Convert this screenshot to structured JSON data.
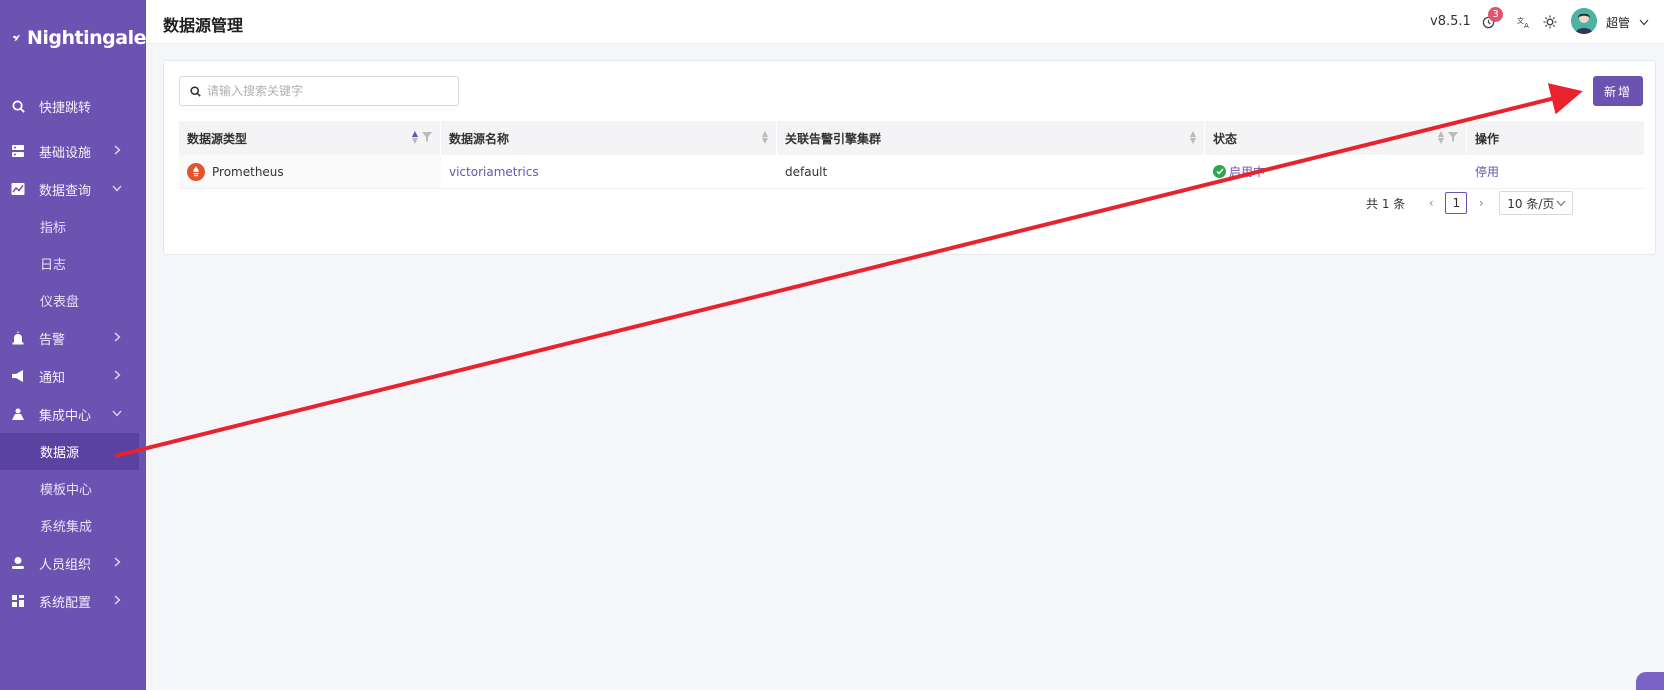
{
  "app": {
    "name": "Nightingale"
  },
  "sidebar": {
    "items": [
      {
        "label": "快捷跳转",
        "icon": "search-icon",
        "has_children": false
      },
      {
        "label": "基础设施",
        "icon": "server-icon",
        "has_children": true,
        "expanded": false
      },
      {
        "label": "数据查询",
        "icon": "chart-icon",
        "has_children": true,
        "expanded": true,
        "children": [
          {
            "label": "指标"
          },
          {
            "label": "日志"
          },
          {
            "label": "仪表盘"
          }
        ]
      },
      {
        "label": "告警",
        "icon": "alarm-icon",
        "has_children": true,
        "expanded": false
      },
      {
        "label": "通知",
        "icon": "megaphone-icon",
        "has_children": true,
        "expanded": false
      },
      {
        "label": "集成中心",
        "icon": "integration-icon",
        "has_children": true,
        "expanded": true,
        "children": [
          {
            "label": "数据源",
            "active": true
          },
          {
            "label": "模板中心"
          },
          {
            "label": "系统集成"
          }
        ]
      },
      {
        "label": "人员组织",
        "icon": "user-icon",
        "has_children": true,
        "expanded": false
      },
      {
        "label": "系统配置",
        "icon": "grid-icon",
        "has_children": true,
        "expanded": false
      }
    ]
  },
  "header": {
    "title": "数据源管理",
    "version": "v8.5.1",
    "notification_count": "3",
    "username": "超管"
  },
  "toolbar": {
    "search_placeholder": "请输入搜索关键字",
    "add_label": "新增"
  },
  "table": {
    "columns": [
      "数据源类型",
      "数据源名称",
      "关联告警引擎集群",
      "状态",
      "操作"
    ],
    "rows": [
      {
        "type": "Prometheus",
        "name": "victoriametrics",
        "cluster": "default",
        "status": "启用中",
        "action": "停用"
      }
    ]
  },
  "pagination": {
    "total": "共 1 条",
    "current": "1",
    "page_size": "10 条/页"
  },
  "colors": {
    "brand": "#6c53b1",
    "annotation": "#e8232e",
    "status_ok": "#2ba84a"
  }
}
